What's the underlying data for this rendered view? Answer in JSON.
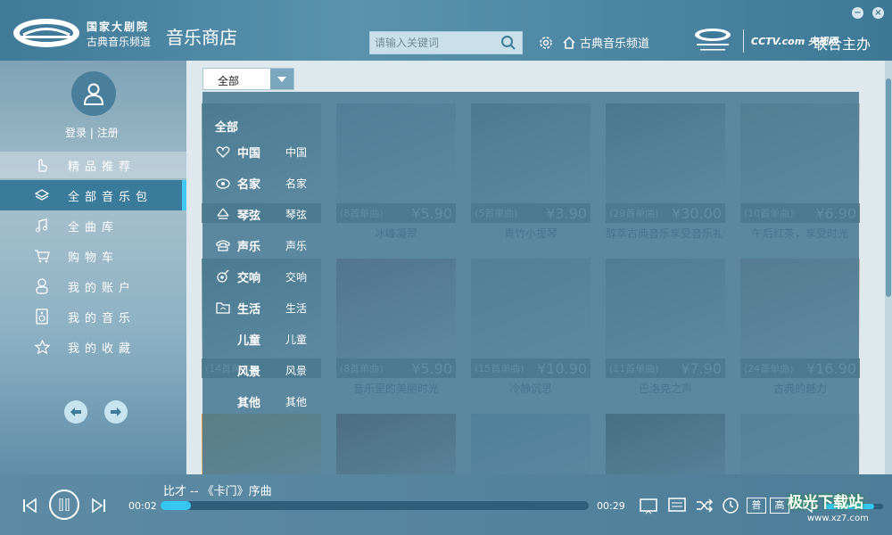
{
  "header": {
    "logo_line1": "国家大剧院",
    "logo_line2": "古典音乐频道",
    "app_title": "音乐商店",
    "search_placeholder": "请输入关键词",
    "channel_link": "古典音乐频道",
    "partner_logo": "CCTV.com 央视网",
    "joint_label": "联合主办"
  },
  "sidebar": {
    "login": "登录",
    "separator": "|",
    "register": "注册",
    "items": [
      {
        "label": "精品推荐",
        "icon": "hand-pointer-icon",
        "state": "hover"
      },
      {
        "label": "全部音乐包",
        "icon": "layers-icon",
        "state": "active"
      },
      {
        "label": "全曲库",
        "icon": "music-note-icon",
        "state": "normal"
      },
      {
        "label": "购物车",
        "icon": "cart-icon",
        "state": "normal"
      },
      {
        "label": "我的账户",
        "icon": "user-icon",
        "state": "normal"
      },
      {
        "label": "我的音乐",
        "icon": "speaker-icon",
        "state": "normal"
      },
      {
        "label": "我的收藏",
        "icon": "star-icon",
        "state": "normal"
      }
    ]
  },
  "filter": {
    "selected": "全部"
  },
  "category_menu": {
    "all_label": "全部",
    "items": [
      {
        "name": "中国",
        "sub": "中国",
        "icon": "heart-icon"
      },
      {
        "name": "名家",
        "sub": "名家",
        "icon": "masters-icon"
      },
      {
        "name": "琴弦",
        "sub": "琴弦",
        "icon": "strings-icon"
      },
      {
        "name": "声乐",
        "sub": "声乐",
        "icon": "vocal-icon"
      },
      {
        "name": "交响",
        "sub": "交响",
        "icon": "symphony-icon"
      },
      {
        "name": "生活",
        "sub": "生活",
        "icon": "folder-icon"
      },
      {
        "name": "儿童",
        "sub": "儿童",
        "icon": ""
      },
      {
        "name": "风景",
        "sub": "风景",
        "icon": ""
      },
      {
        "name": "其他",
        "sub": "其他",
        "icon": ""
      }
    ]
  },
  "cards": [
    {
      "count": "",
      "price": "",
      "title": "",
      "color": "#6d8e96"
    },
    {
      "count": "(8首单曲)",
      "price": "¥5.90",
      "title": "冰峰凝翠",
      "color": "#8aa6b3"
    },
    {
      "count": "(5首单曲)",
      "price": "¥3.90",
      "title": "青竹小提琴",
      "color": "#6f8c8c"
    },
    {
      "count": "(29首单曲)",
      "price": "¥30.00",
      "title": "醇萃古典音乐享受音乐礼包",
      "color": "#5d7c79"
    },
    {
      "count": "(10首单曲)",
      "price": "¥6.90",
      "title": "午后红茶，享受时光",
      "color": "#a0a59a"
    },
    {
      "count": "(14首单曲)",
      "price": "",
      "title": "",
      "color": "#6b8b8e"
    },
    {
      "count": "(8首单曲)",
      "price": "¥5.90",
      "title": "音乐里的美丽时光",
      "color": "#9a6a78"
    },
    {
      "count": "(15首单曲)",
      "price": "¥10.90",
      "title": "冷静沉思",
      "color": "#9fb0b8"
    },
    {
      "count": "(11首单曲)",
      "price": "¥7.90",
      "title": "巴洛克之声",
      "color": "#8f9aa0"
    },
    {
      "count": "(24首单曲)",
      "price": "¥16.90",
      "title": "古典的魅力",
      "color": "#b39a90"
    },
    {
      "count": "",
      "price": "",
      "title": "",
      "color": "#d99a3b"
    },
    {
      "count": "",
      "price": "",
      "title": "",
      "color": "#7a2f22"
    },
    {
      "count": "",
      "price": "",
      "title": "",
      "color": "#8fb6cf"
    },
    {
      "count": "",
      "price": "",
      "title": "",
      "color": "#4d3a22"
    },
    {
      "count": "",
      "price": "",
      "title": "",
      "color": "#b8c2c6"
    }
  ],
  "player": {
    "song": "比才 -- 《卡门》序曲",
    "time_current": "00:02",
    "time_total": "00:29",
    "progress": 0.07,
    "volume": 0.85,
    "quality_standard": "普",
    "quality_high": "高"
  },
  "watermark": {
    "line1": "极光下载站",
    "line2": "www.xz7.com"
  },
  "colors": {
    "accent": "#36c6f2",
    "active_nav": "#3a7b9b",
    "header": "#4a86a3"
  }
}
